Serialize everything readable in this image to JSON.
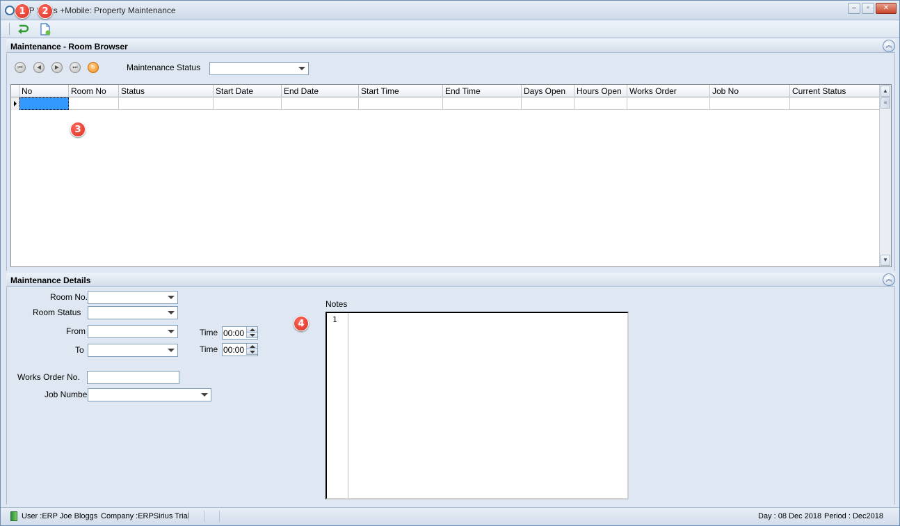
{
  "window": {
    "title": "ERP Sirius +Mobile: Property Maintenance",
    "minimize": "–",
    "maximize": "▫",
    "close": "✕"
  },
  "toolbar": {
    "buttons": [
      {
        "name": "return-icon",
        "color": "#2e9a2e"
      },
      {
        "name": "new-document-icon",
        "color": "#3b78c4"
      }
    ]
  },
  "badges": [
    "1",
    "2",
    "3",
    "4"
  ],
  "room_browser": {
    "title": "Maintenance - Room Browser",
    "collapse": "︽",
    "nav": {
      "first": "⏮",
      "prev": "◀",
      "next": "▶",
      "last": "⏭",
      "refresh": "↻"
    },
    "maintenance_status_label": "Maintenance Status",
    "maintenance_status_value": "",
    "columns": [
      "No",
      "Room No",
      "Status",
      "Start Date",
      "End Date",
      "Start Time",
      "End Time",
      "Days Open",
      "Hours Open",
      "Works Order",
      "Job No",
      "Current Status"
    ],
    "rows": [
      [
        "",
        "",
        "",
        "",
        "",
        "",
        "",
        "",
        "",
        "",
        "",
        ""
      ]
    ],
    "scroll_up": "▲",
    "scroll_down": "▼",
    "scroll_thumb": "≡"
  },
  "details": {
    "title": "Maintenance Details",
    "collapse": "︽",
    "room_no_label": "Room No.",
    "room_status_label": "Room Status",
    "from_label": "From",
    "to_label": "To",
    "time_label_1": "Time",
    "time_label_2": "Time",
    "time_from": "00:00",
    "time_to": "00:00",
    "works_order_label": "Works Order No.",
    "job_number_label": "Job Number",
    "notes_label": "Notes",
    "notes_line_number": "1"
  },
  "status_bar": {
    "user": "User :ERP Joe Bloggs",
    "company": "Company :ERPSirius Trial",
    "day": "Day : 08 Dec 2018",
    "period": "Period : Dec2018"
  }
}
